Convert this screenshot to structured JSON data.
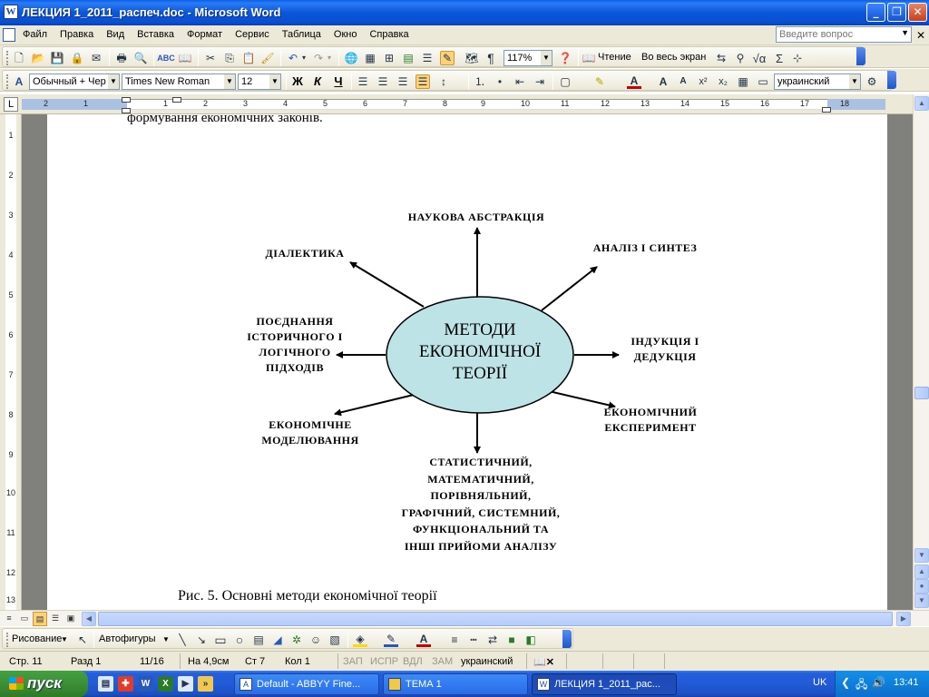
{
  "window": {
    "title": "ЛЕКЦИЯ 1_2011_распеч.doc - Microsoft Word"
  },
  "menu": {
    "items": [
      "Файл",
      "Правка",
      "Вид",
      "Вставка",
      "Формат",
      "Сервис",
      "Таблица",
      "Окно",
      "Справка"
    ],
    "help_placeholder": "Введите вопрос"
  },
  "standard_toolbar": {
    "zoom": "117%",
    "reading_mode": "Чтение",
    "full_screen": "Во весь экран"
  },
  "format_toolbar": {
    "style": "Обычный + Чер",
    "font": "Times New Roman",
    "size": "12",
    "bold": "Ж",
    "italic": "К",
    "underline": "Ч",
    "language": "украинский"
  },
  "ruler": {
    "h_ticks": [
      "2",
      "1",
      "1",
      "2",
      "3",
      "4",
      "5",
      "6",
      "7",
      "8",
      "9",
      "10",
      "11",
      "12",
      "13",
      "14",
      "15",
      "16",
      "17",
      "18"
    ],
    "v_ticks": [
      "1",
      "2",
      "3",
      "4",
      "5",
      "6",
      "7",
      "8",
      "9",
      "10",
      "11",
      "12",
      "13",
      "14"
    ]
  },
  "document": {
    "top_line": "формування економічних законів.",
    "caption": "Рис. 5. Основні методи економічної теорії",
    "diagram": {
      "center": [
        "МЕТОДИ",
        "ЕКОНОМІЧНОЇ",
        "ТЕОРІЇ"
      ],
      "top": "НАУКОВА АБСТРАКЦІЯ",
      "top_right": "АНАЛІЗ І СИНТЕЗ",
      "top_left": "ДІАЛЕКТИКА",
      "left": [
        "ПОЄДНАННЯ",
        "ІСТОРИЧНОГО І",
        "ЛОГІЧНОГО",
        "ПІДХОДІВ"
      ],
      "right": [
        "ІНДУКЦІЯ І",
        "ДЕДУКЦІЯ"
      ],
      "bottom_left": [
        "ЕКОНОМІЧНЕ",
        "МОДЕЛЮВАННЯ"
      ],
      "bottom_right": [
        "ЕКОНОМІЧНИЙ",
        "ЕКСПЕРИМЕНТ"
      ],
      "bottom": [
        "СТАТИСТИЧНИЙ,",
        "МАТЕМАТИЧНИЙ,",
        "ПОРІВНЯЛЬНИЙ,",
        "ГРАФІЧНИЙ, СИСТЕМНИЙ,",
        "ФУНКЦІОНАЛЬНИЙ ТА",
        "ІНШІ ПРИЙОМИ АНАЛІЗУ"
      ]
    }
  },
  "draw_toolbar": {
    "drawing": "Рисование",
    "autoshapes": "Автофигуры"
  },
  "status": {
    "page": "Стр. 11",
    "section": "Разд 1",
    "pages": "11/16",
    "at": "На 4,9см",
    "line": "Ст 7",
    "col": "Кол 1",
    "rec": "ЗАП",
    "trk": "ИСПР",
    "ext": "ВДЛ",
    "ovr": "ЗАМ",
    "language": "украинский"
  },
  "taskbar": {
    "start": "пуск",
    "tasks": [
      "Default - ABBYY Fine...",
      "ТЕМА 1",
      "ЛЕКЦИЯ 1_2011_рас..."
    ],
    "lang": "UK",
    "clock": "13:41"
  }
}
